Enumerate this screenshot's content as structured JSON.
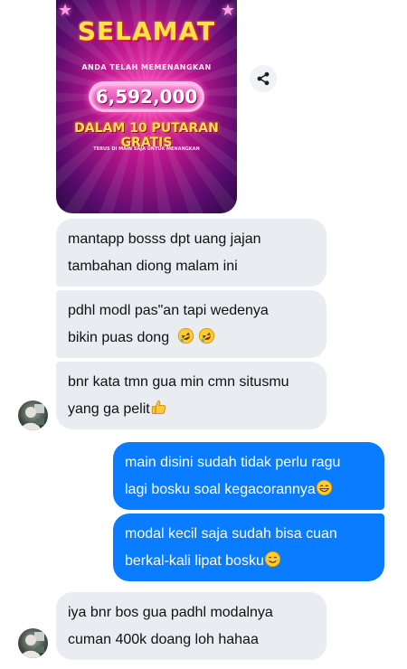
{
  "shared_image": {
    "title": "SELAMAT",
    "subtitle": "ANDA TELAH MEMENANGKAN",
    "amount": "6,592,000",
    "headline": "DALAM 10 PUTARAN GRATIS",
    "caption": "TERUS DI MAIN SAJA UNTUK MENANGKAN"
  },
  "share_icon": "share-icon",
  "messages": [
    {
      "direction": "incoming",
      "lines": [
        "mantapp bosss dpt uang jajan",
        "tambahan diong malam ini"
      ]
    },
    {
      "direction": "incoming",
      "lines": [
        "pdhl modl pas\"an tapi wedenya",
        "bikin puas dong"
      ],
      "emojis": [
        "rofl-emoji",
        "rofl-emoji"
      ]
    },
    {
      "direction": "incoming",
      "lines": [
        "bnr kata tmn gua min cmn situsmu",
        "yang ga pelit"
      ],
      "emojis": [
        "thumbs-up-emoji"
      ]
    },
    {
      "direction": "outgoing",
      "lines": [
        "main disini sudah tidak perlu ragu",
        "lagi bosku soal kegacorannya"
      ],
      "emojis": [
        "grinning-emoji"
      ]
    },
    {
      "direction": "outgoing",
      "lines": [
        "modal kecil saja sudah bisa cuan",
        "berkal-kali lipat bosku"
      ],
      "emojis": [
        "smiling-emoji"
      ]
    },
    {
      "direction": "incoming",
      "lines": [
        "iya bnr bos gua padhl modalnya",
        "cuman 400k doang loh hahaa"
      ]
    }
  ],
  "colors": {
    "incoming_bubble": "#e9ecf1",
    "outgoing_bubble": "#0a7cff",
    "share_button": "#f0f2f5"
  }
}
